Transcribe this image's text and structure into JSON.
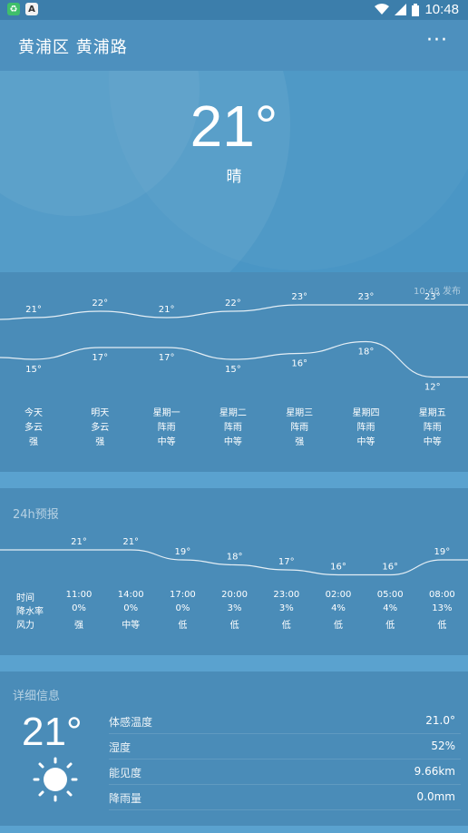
{
  "status_bar": {
    "time": "10:48",
    "app_icons": [
      "recycle-app-icon",
      "a-app-icon"
    ],
    "status_icons": [
      "wifi-icon",
      "signal-icon",
      "battery-icon"
    ]
  },
  "header": {
    "location": "黄浦区 黄浦路",
    "menu_icon": "more-horizontal-icon"
  },
  "current": {
    "temperature": "21°",
    "condition": "晴"
  },
  "weekly": {
    "published": "10:48 发布",
    "days": [
      {
        "day": "今天",
        "weather": "多云",
        "wind": "强",
        "high": "21°",
        "low": "15°"
      },
      {
        "day": "明天",
        "weather": "多云",
        "wind": "强",
        "high": "22°",
        "low": "17°"
      },
      {
        "day": "星期一",
        "weather": "阵雨",
        "wind": "中等",
        "high": "21°",
        "low": "17°"
      },
      {
        "day": "星期二",
        "weather": "阵雨",
        "wind": "中等",
        "high": "22°",
        "low": "15°"
      },
      {
        "day": "星期三",
        "weather": "阵雨",
        "wind": "强",
        "high": "23°",
        "low": "16°"
      },
      {
        "day": "星期四",
        "weather": "阵雨",
        "wind": "中等",
        "high": "23°",
        "low": "18°"
      },
      {
        "day": "星期五",
        "weather": "阵雨",
        "wind": "中等",
        "high": "23°",
        "low": "12°"
      }
    ]
  },
  "hourly": {
    "title": "24h预报",
    "row_labels": {
      "time": "时间",
      "precip": "降水率",
      "wind": "风力"
    },
    "hours": [
      {
        "time": "11:00",
        "temp": "21°",
        "precip": "0%",
        "wind": "强"
      },
      {
        "time": "14:00",
        "temp": "21°",
        "precip": "0%",
        "wind": "中等"
      },
      {
        "time": "17:00",
        "temp": "19°",
        "precip": "0%",
        "wind": "低"
      },
      {
        "time": "20:00",
        "temp": "18°",
        "precip": "3%",
        "wind": "低"
      },
      {
        "time": "23:00",
        "temp": "17°",
        "precip": "3%",
        "wind": "低"
      },
      {
        "time": "02:00",
        "temp": "16°",
        "precip": "4%",
        "wind": "低"
      },
      {
        "time": "05:00",
        "temp": "16°",
        "precip": "4%",
        "wind": "低"
      },
      {
        "time": "08:00",
        "temp": "19°",
        "precip": "13%",
        "wind": "低"
      }
    ]
  },
  "details": {
    "title": "详细信息",
    "temperature": "21°",
    "icon": "sun-icon",
    "rows": [
      {
        "label": "体感温度",
        "value": "21.0°"
      },
      {
        "label": "湿度",
        "value": "52%"
      },
      {
        "label": "能见度",
        "value": "9.66km"
      },
      {
        "label": "降雨量",
        "value": "0.0mm"
      }
    ]
  }
}
